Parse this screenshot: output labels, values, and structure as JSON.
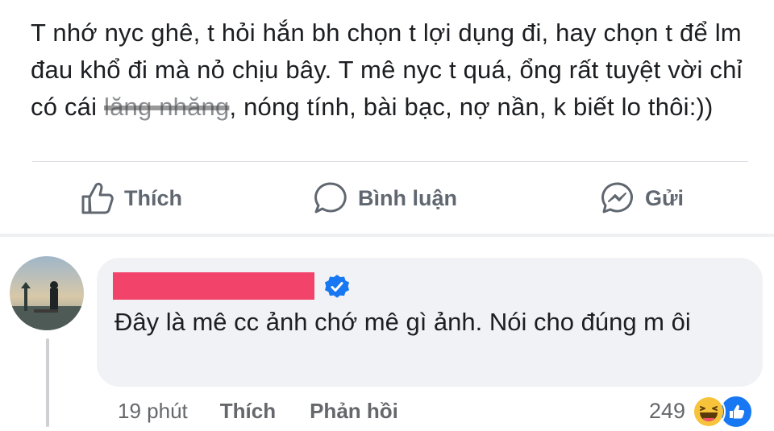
{
  "post": {
    "text_before": "T nhớ nyc ghê, t hỏi hắn bh chọn t lợi dụng đi, hay chọn t để lm đau khổ đi mà nỏ chịu bây. T mê nyc t quá, ổng rất tuyệt vời chỉ có cái ",
    "text_struck": "lăng nhăng",
    "text_after": ", nóng tính, bài bạc, nợ nần, k biết lo thôi:))"
  },
  "actions": {
    "like_label": "Thích",
    "comment_label": "Bình luận",
    "send_label": "Gửi"
  },
  "comment": {
    "text": "Đây là mê cc ảnh chớ mê gì ảnh. Nói cho đúng m ôi",
    "time": "19 phút",
    "like_label": "Thích",
    "reply_label": "Phản hồi",
    "reaction_count": "249"
  },
  "colors": {
    "redaction": "#f2446b",
    "verified": "#1877f2",
    "bubble": "#f0f2f5"
  },
  "icons": [
    "thumbs-up-icon",
    "comment-icon",
    "messenger-icon",
    "verified-badge-icon",
    "haha-reaction-icon",
    "like-reaction-icon"
  ]
}
